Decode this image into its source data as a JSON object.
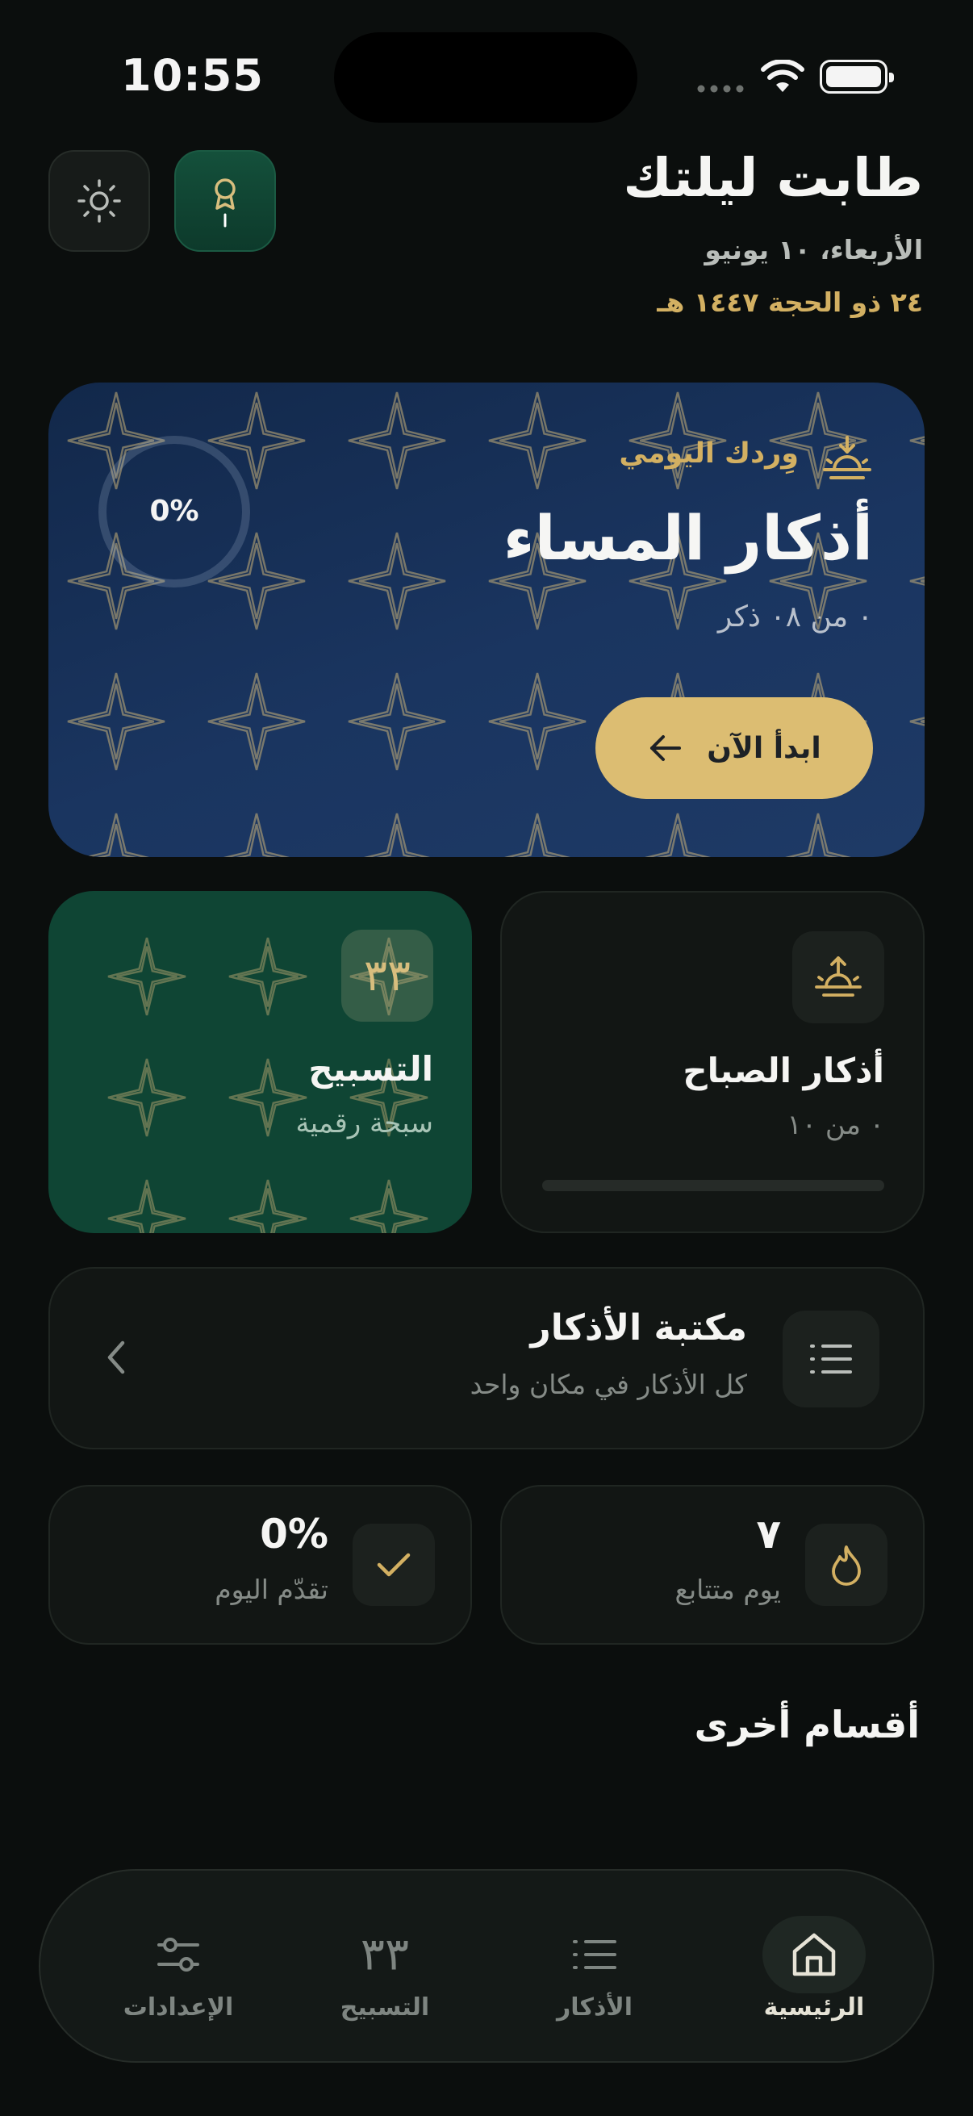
{
  "status_bar": {
    "time": "10:55"
  },
  "header": {
    "title": "طابت ليلتك",
    "gregorian_date": "الأربعاء، ١٠ يونيو",
    "hijri_date": "٢٤ ذو الحجة ١٤٤٧ هـ",
    "settings_icon": "sun-icon",
    "award_icon": "award-icon"
  },
  "hero": {
    "label": "وِردك اليومي",
    "title": "أذكار المساء",
    "subtitle": "٠ من ٠٨ ذكر",
    "progress_text": "0%",
    "progress": 0,
    "button_label": "ابدأ الآن",
    "accent": "#dcbd72"
  },
  "tasbih_card": {
    "badge": "٣٣",
    "title": "التسبيح",
    "subtitle": "سبحة رقمية"
  },
  "morning_card": {
    "title": "أذكار الصباح",
    "subtitle": "٠ من ١٠",
    "progress": 0
  },
  "library_card": {
    "title": "مكتبة الأذكار",
    "subtitle": "كل الأذكار في مكان واحد"
  },
  "stats": {
    "streak_value": "٧",
    "streak_label": "يوم متتابع",
    "progress_value": "0%",
    "progress_label": "تقدّم اليوم"
  },
  "sections": {
    "other_title": "أقسام أخرى"
  },
  "tabbar": {
    "home": "الرئيسية",
    "adhkar": "الأذكار",
    "tasbih": "التسبيح",
    "tasbih_glyph": "٣٣",
    "settings": "الإعدادات"
  },
  "colors": {
    "background": "#0b0e0d",
    "gold": "#d3b062",
    "hero_blue": "#1a3560",
    "tasbih_green": "#0f4534"
  }
}
